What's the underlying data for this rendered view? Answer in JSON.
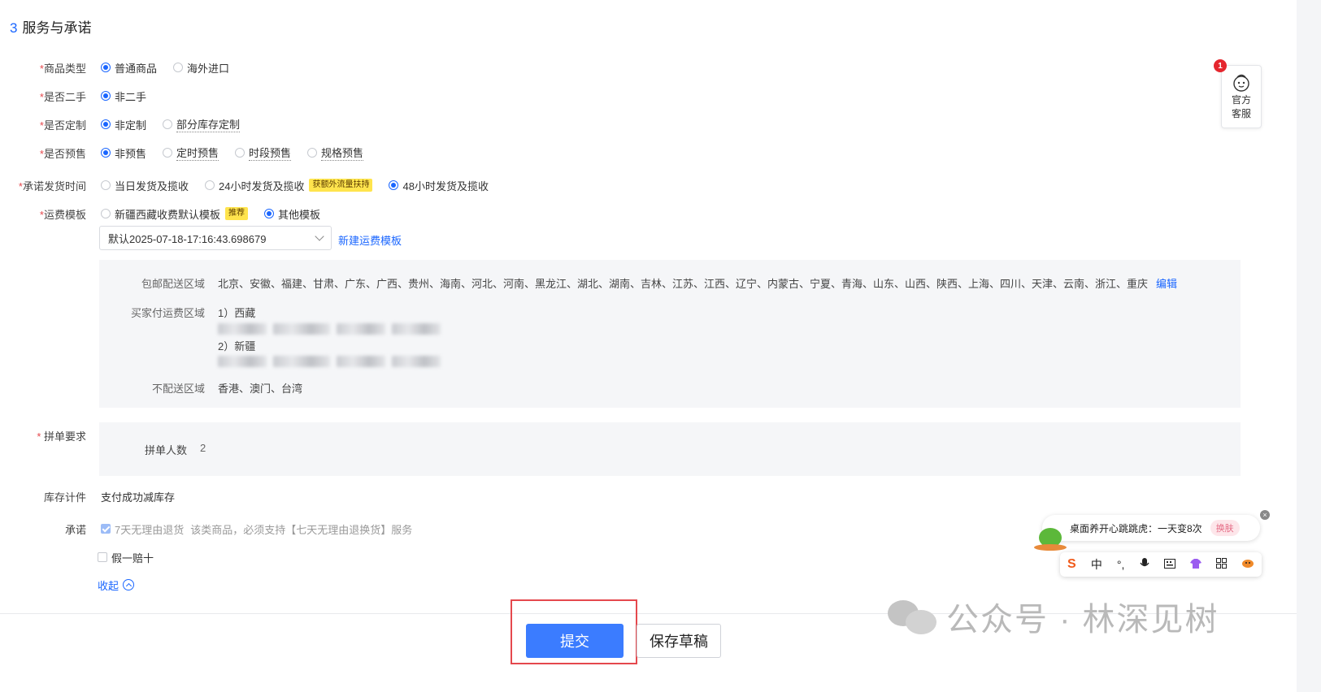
{
  "section": {
    "num": "3",
    "title": "服务与承诺"
  },
  "form": {
    "goods_type": {
      "label": "商品类型",
      "options": [
        "普通商品",
        "海外进口"
      ]
    },
    "second_hand": {
      "label": "是否二手",
      "options": [
        "非二手"
      ]
    },
    "customize": {
      "label": "是否定制",
      "options": [
        "非定制",
        "部分库存定制"
      ]
    },
    "presale": {
      "label": "是否预售",
      "options": [
        "非预售",
        "定时预售",
        "时段预售",
        "规格预售"
      ]
    },
    "ship_time": {
      "label": "承诺发货时间",
      "options": [
        "当日发货及揽收",
        "24小时发货及揽收",
        "48小时发货及揽收"
      ],
      "tag": "获额外流量扶持"
    },
    "freight": {
      "label": "运费模板",
      "options": [
        "新疆西藏收费默认模板",
        "其他模板"
      ],
      "tag": "推荐",
      "selected_template": "默认2025-07-18-17:16:43.698679",
      "new_link": "新建运费模板"
    },
    "shipping": {
      "free_label": "包邮配送区域",
      "free_value": "北京、安徽、福建、甘肃、广东、广西、贵州、海南、河北、河南、黑龙江、湖北、湖南、吉林、江苏、江西、辽宁、内蒙古、宁夏、青海、山东、山西、陕西、上海、四川、天津、云南、浙江、重庆",
      "edit": "编辑",
      "paid_label": "买家付运费区域",
      "paid_1": "1）西藏",
      "paid_2": "2）新疆",
      "no_label": "不配送区域",
      "no_value": "香港、澳门、台湾"
    },
    "group": {
      "label": "拼单要求",
      "count_label": "拼单人数",
      "count_value": "2"
    },
    "stock": {
      "label": "库存计件",
      "value": "支付成功减库存"
    },
    "promise": {
      "label": "承诺",
      "item1": "7天无理由退货",
      "item1_note": "该类商品，必须支持【七天无理由退换货】服务",
      "item2": "假一赔十",
      "collapse": "收起"
    }
  },
  "footer": {
    "submit": "提交",
    "draft": "保存草稿"
  },
  "watermark": "公众号 · 林深见树",
  "service_widget": {
    "badge": "1",
    "line1": "官方",
    "line2": "客服"
  },
  "ime": {
    "tip": "桌面养开心跳跳虎：一天变8次",
    "skin": "换肤",
    "lang": "中",
    "logo": "S"
  }
}
